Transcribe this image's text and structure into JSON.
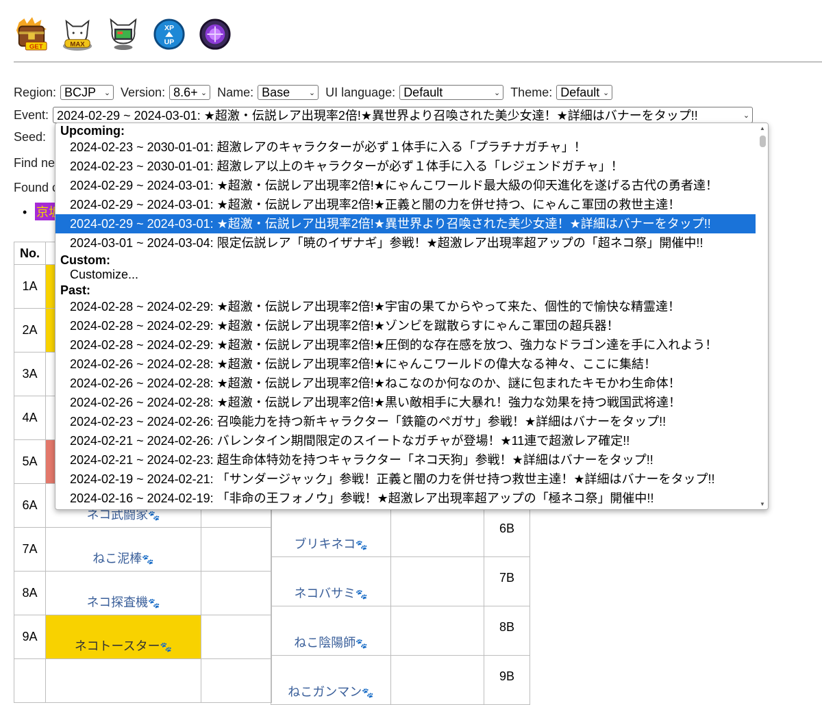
{
  "toolbar_icons": [
    {
      "name": "treasure-get-icon",
      "badge": "GET"
    },
    {
      "name": "cat-max-icon",
      "badge": "MAX"
    },
    {
      "name": "cat-computer-icon",
      "badge": ""
    },
    {
      "name": "xp-up-icon",
      "badge": "XP UP"
    },
    {
      "name": "purple-orb-icon",
      "badge": ""
    }
  ],
  "controls": {
    "region_label": "Region:",
    "region_value": "BCJP",
    "version_label": "Version:",
    "version_value": "8.6+",
    "name_label": "Name:",
    "name_value": "Base",
    "uilang_label": "UI language:",
    "uilang_value": "Default",
    "theme_label": "Theme:",
    "theme_value": "Default",
    "event_label": "Event:",
    "event_value": "2024-02-29 ~ 2024-03-01: ★超激・伝説レア出現率2倍!★異世界より召喚された美少女達！★詳細はバナーをタップ!!",
    "seed_label": "Seed:"
  },
  "partial_text": {
    "find": "Find ne",
    "found": "Found c",
    "kyoto": "京坂"
  },
  "dropdown": {
    "upcoming_label": "Upcoming:",
    "upcoming": [
      "2024-02-23 ~ 2030-01-01: 超激レアのキャラクターが必ず１体手に入る「プラチナガチャ」！",
      "2024-02-23 ~ 2030-01-01: 超激レア以上のキャラクターが必ず１体手に入る「レジェンドガチャ」！",
      "2024-02-29 ~ 2024-03-01: ★超激・伝説レア出現率2倍!★にゃんこワールド最大級の仰天進化を遂げる古代の勇者達！",
      "2024-02-29 ~ 2024-03-01: ★超激・伝説レア出現率2倍!★正義と闇の力を併せ持つ、にゃんこ軍団の救世主達！",
      "2024-02-29 ~ 2024-03-01: ★超激・伝説レア出現率2倍!★異世界より召喚された美少女達！★詳細はバナーをタップ!!",
      "2024-03-01 ~ 2024-03-04: 限定伝説レア「暁のイザナギ」参戦！★超激レア出現率超アップの「超ネコ祭」開催中!!"
    ],
    "custom_label": "Custom:",
    "custom": [
      "Customize..."
    ],
    "past_label": "Past:",
    "past": [
      "2024-02-28 ~ 2024-02-29: ★超激・伝説レア出現率2倍!★宇宙の果てからやって来た、個性的で愉快な精霊達！",
      "2024-02-28 ~ 2024-02-29: ★超激・伝説レア出現率2倍!★ゾンビを蹴散らすにゃんこ軍団の超兵器！",
      "2024-02-28 ~ 2024-02-29: ★超激・伝説レア出現率2倍!★圧倒的な存在感を放つ、強力なドラゴン達を手に入れよう！",
      "2024-02-26 ~ 2024-02-28: ★超激・伝説レア出現率2倍!★にゃんこワールドの偉大なる神々、ここに集結！",
      "2024-02-26 ~ 2024-02-28: ★超激・伝説レア出現率2倍!★ねこなのか何なのか、謎に包まれたキモかわ生命体！",
      "2024-02-26 ~ 2024-02-28: ★超激・伝説レア出現率2倍!★黒い敵相手に大暴れ！強力な効果を持つ戦国武将達！",
      "2024-02-23 ~ 2024-02-26: 召喚能力を持つ新キャラクター「鉄籠のペガサ」参戦！★詳細はバナーをタップ!!",
      "2024-02-21 ~ 2024-02-26: バレンタイン期間限定のスイートなガチャが登場！★11連で超激レア確定!!",
      "2024-02-21 ~ 2024-02-23: 超生命体特効を持つキャラクター「ネコ天狗」参戦！★詳細はバナーをタップ!!",
      "2024-02-19 ~ 2024-02-21: 「サンダージャック」参戦！正義と闇の力を併せ持つ救世主達！★詳細はバナーをタップ!!",
      "2024-02-16 ~ 2024-02-19: 「非命の王フォノウ」参戦！★超激レア出現率超アップの「極ネコ祭」開催中!!"
    ]
  },
  "table": {
    "header_no": "No.",
    "rows": [
      {
        "no": "1A",
        "name": "",
        "color": "yellow"
      },
      {
        "no": "2A",
        "name": "",
        "color": "yellow"
      },
      {
        "no": "3A",
        "name": "",
        "color": ""
      },
      {
        "no": "4A",
        "name": "",
        "color": ""
      },
      {
        "no": "5A",
        "name": "",
        "color": "red"
      },
      {
        "no": "6A",
        "name": "ネコ武闘家",
        "color": ""
      },
      {
        "no": "7A",
        "name": "ねこ泥棒",
        "color": ""
      },
      {
        "no": "8A",
        "name": "ネコ探査機",
        "color": ""
      },
      {
        "no": "9A",
        "name": "ネコトースター",
        "color": "yellow"
      },
      {
        "no": "",
        "name": "",
        "color": ""
      }
    ],
    "right_rows": [
      {
        "name": "ブリキネコ",
        "no": "6B"
      },
      {
        "name": "ネコバサミ",
        "no": "7B"
      },
      {
        "name": "ねこ陰陽師",
        "no": "8B"
      },
      {
        "name": "ねこガンマン",
        "no": "9B"
      }
    ],
    "paw_glyph": "🐾"
  }
}
